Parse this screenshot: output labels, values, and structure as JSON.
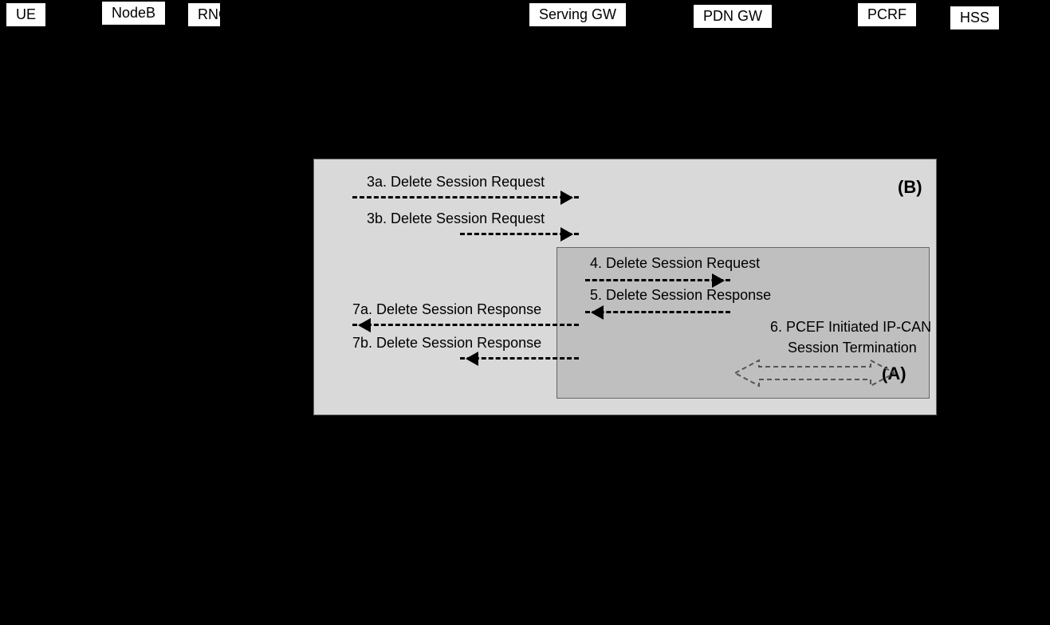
{
  "nodes": {
    "ue": "UE",
    "nodeb": "NodeB",
    "rnc": "RNC",
    "sgw": "Serving GW",
    "pgw": "PDN GW",
    "pcrf": "PCRF",
    "hss": "HSS"
  },
  "regions": {
    "b": "(B)",
    "a": "(A)"
  },
  "messages": {
    "m3a": "3a. Delete Session Request",
    "m3b": "3b. Delete Session Request",
    "m4": "4. Delete Session Request",
    "m5": "5. Delete Session Response",
    "m6a": "6. PCEF Initiated IP-CAN",
    "m6b": "Session Termination",
    "m7a": "7a. Delete Session Response",
    "m7b": "7b. Delete Session Response"
  }
}
